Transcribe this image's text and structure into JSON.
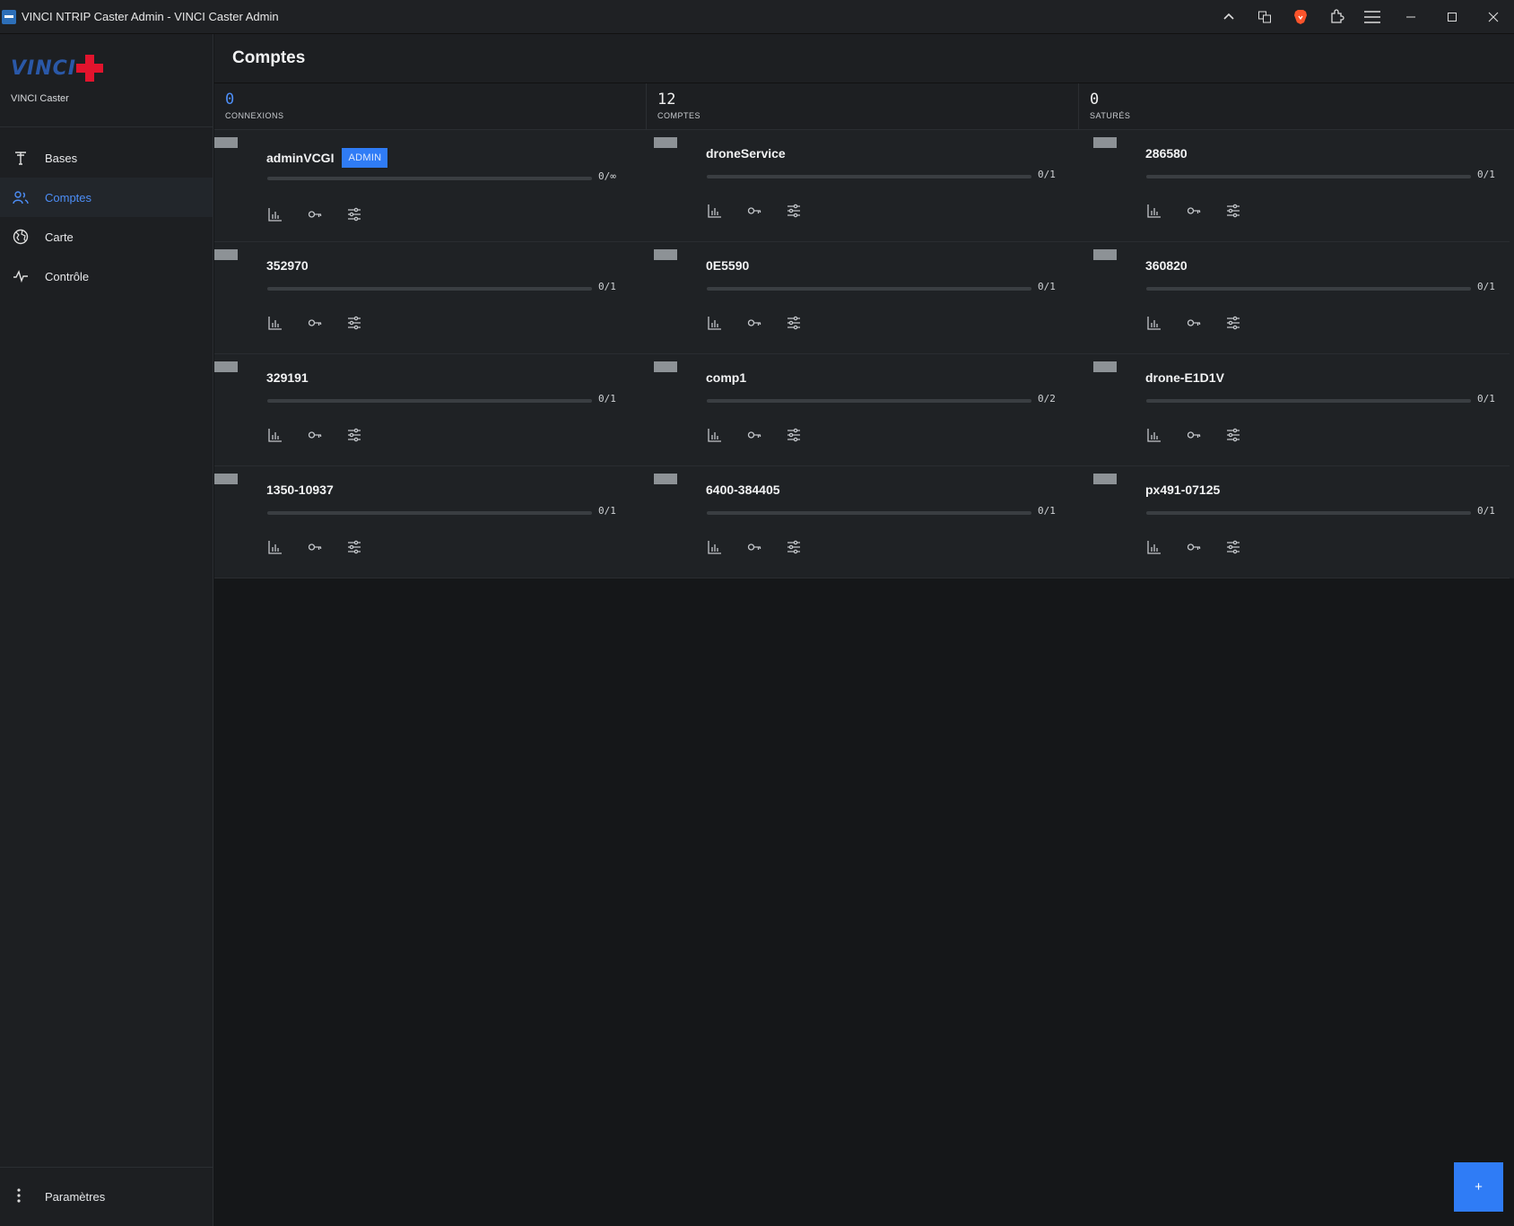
{
  "window": {
    "title": "VINCI NTRIP Caster Admin - VINCI Caster Admin",
    "controls": [
      "chevron-up-icon",
      "translate-icon",
      "brave-icon",
      "extensions-icon",
      "menu-icon",
      "minimize-icon",
      "maximize-icon",
      "close-icon"
    ]
  },
  "sidebar": {
    "logo_text": "VINCI",
    "app_name": "VINCI Caster",
    "items": [
      {
        "label": "Bases",
        "icon": "antenna-icon",
        "active": false
      },
      {
        "label": "Comptes",
        "icon": "users-icon",
        "active": true
      },
      {
        "label": "Carte",
        "icon": "globe-icon",
        "active": false
      },
      {
        "label": "Contrôle",
        "icon": "pulse-icon",
        "active": false
      }
    ],
    "settings_label": "Paramètres"
  },
  "header": {
    "title": "Comptes"
  },
  "stats": [
    {
      "value": "0",
      "label": "CONNEXIONS",
      "accent": true
    },
    {
      "value": "12",
      "label": "COMPTES",
      "accent": false
    },
    {
      "value": "0",
      "label": "SATURÉS",
      "accent": false
    }
  ],
  "accounts": [
    {
      "name": "adminVCGI",
      "badge": "ADMIN",
      "quota": "0/∞",
      "usage": 0
    },
    {
      "name": "droneService",
      "badge": "",
      "quota": "0/1",
      "usage": 0
    },
    {
      "name": "286580",
      "badge": "",
      "quota": "0/1",
      "usage": 0
    },
    {
      "name": "352970",
      "badge": "",
      "quota": "0/1",
      "usage": 0
    },
    {
      "name": "0E5590",
      "badge": "",
      "quota": "0/1",
      "usage": 0
    },
    {
      "name": "360820",
      "badge": "",
      "quota": "0/1",
      "usage": 0
    },
    {
      "name": "329191",
      "badge": "",
      "quota": "0/1",
      "usage": 0
    },
    {
      "name": "comp1",
      "badge": "",
      "quota": "0/2",
      "usage": 0
    },
    {
      "name": "drone-E1D1V",
      "badge": "",
      "quota": "0/1",
      "usage": 0
    },
    {
      "name": "1350-10937",
      "badge": "",
      "quota": "0/1",
      "usage": 0
    },
    {
      "name": "6400-384405",
      "badge": "",
      "quota": "0/1",
      "usage": 0
    },
    {
      "name": "px491-07125",
      "badge": "",
      "quota": "0/1",
      "usage": 0
    }
  ],
  "card_actions": [
    "stats-icon",
    "key-icon",
    "sliders-icon"
  ],
  "fab_label": "+",
  "colors": {
    "accent": "#2f7cf6",
    "background": "#151719",
    "panel": "#1d1f22",
    "logo_red": "#e2142d",
    "logo_blue": "#2a58a8"
  }
}
